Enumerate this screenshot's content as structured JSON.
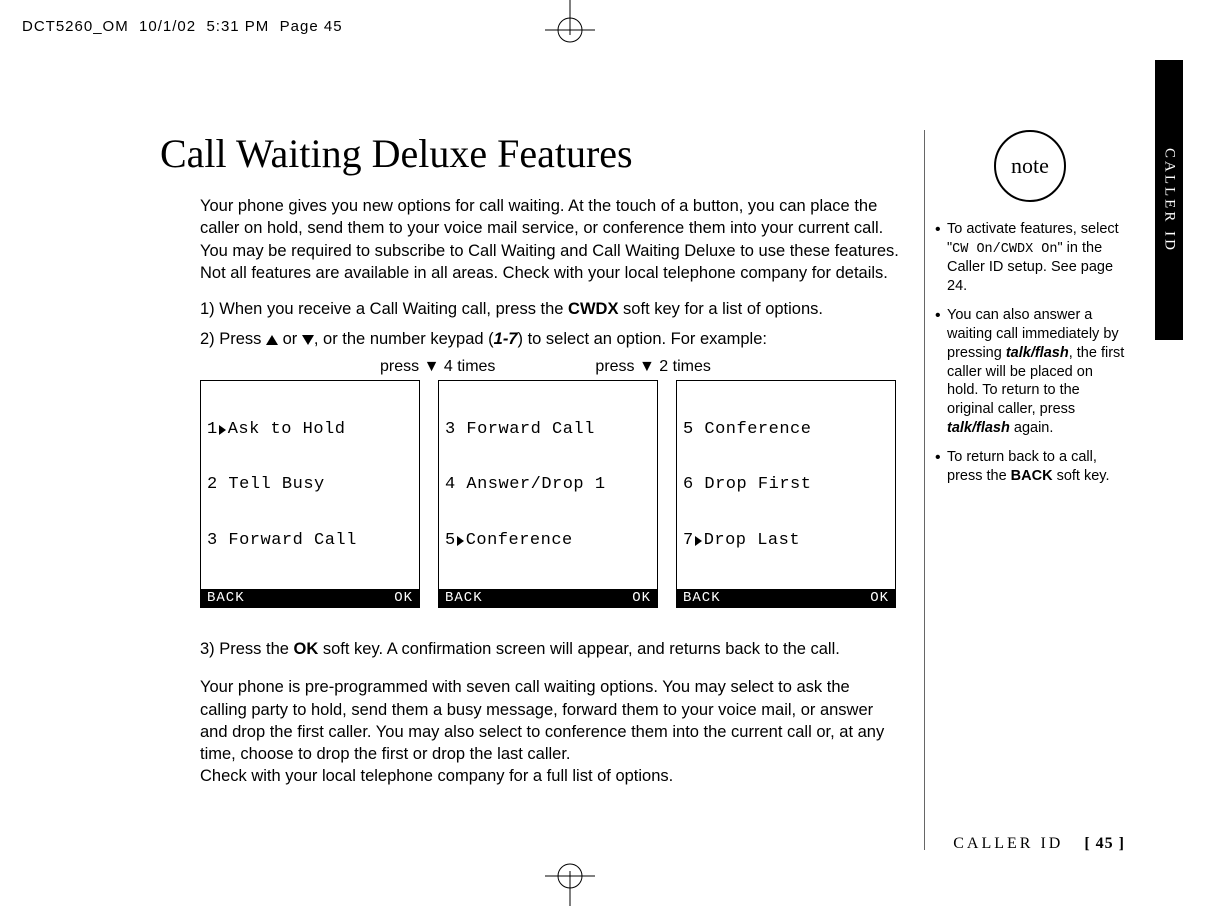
{
  "header": {
    "file": "DCT5260_OM",
    "date": "10/1/02",
    "time": "5:31 PM",
    "pg": "Page 45"
  },
  "title": "Call Waiting Deluxe Features",
  "intro": "Your phone gives you new options for call waiting. At the touch of a button, you can place the caller on hold, send them to your voice mail service, or conference them into your current call. You may be required to subscribe to Call Waiting and Call Waiting Deluxe to use these features. Not all features are available in all areas. Check with your local telephone company for details.",
  "step1_a": "1) When you receive a Call Waiting call, press the ",
  "step1_b": "CWDX",
  "step1_c": " soft key for a list of options.",
  "step2_a": "2) Press ",
  "step2_b": ", or the number keypad (",
  "step2_c": "1-7",
  "step2_d": ") to select an option. For example:",
  "or": " or ",
  "presslabel1": "press ▼ 4 times",
  "presslabel2": "press ▼ 2 times",
  "lcd": {
    "s1": {
      "r1n": "1",
      "r1t": "Ask to Hold",
      "r2": "2 Tell Busy",
      "r3": "3 Forward Call"
    },
    "s2": {
      "r1": "3 Forward Call",
      "r2": "4 Answer/Drop 1",
      "r3n": "5",
      "r3t": "Conference"
    },
    "s3": {
      "r1": "5 Conference",
      "r2": "6 Drop First",
      "r3n": "7",
      "r3t": "Drop Last"
    },
    "back": "BACK",
    "ok": "OK"
  },
  "step3_a": "3) Press the ",
  "step3_b": "OK",
  "step3_c": " soft key. A confirmation screen will appear, and returns back to the call.",
  "outro": "Your phone is pre-programmed with seven call waiting options. You may select to ask the calling party to hold, send them a busy message, forward them to your voice mail, or answer and drop the first caller. You may also select to conference them into the current call or, at any time, choose to drop the first or drop the last caller.\nCheck with your local telephone company for a full list of options.",
  "side": {
    "note_label": "note",
    "n1_a": "To activate features, select \"",
    "n1_mono": "CW On/CWDX On",
    "n1_b": "\" in the Caller ID setup. See page 24.",
    "n2_a": "You can also answer a waiting call immediately by pressing ",
    "n2_tf": "talk/flash",
    "n2_b": ", the first caller will be placed on hold. To return to the original caller, press ",
    "n2_c": " again.",
    "n3_a": "To return back to a call, press the ",
    "n3_b": "BACK",
    "n3_c": " soft key."
  },
  "tab": "CALLER ID",
  "footer": {
    "section": "CALLER ID",
    "page": "[ 45 ]"
  }
}
